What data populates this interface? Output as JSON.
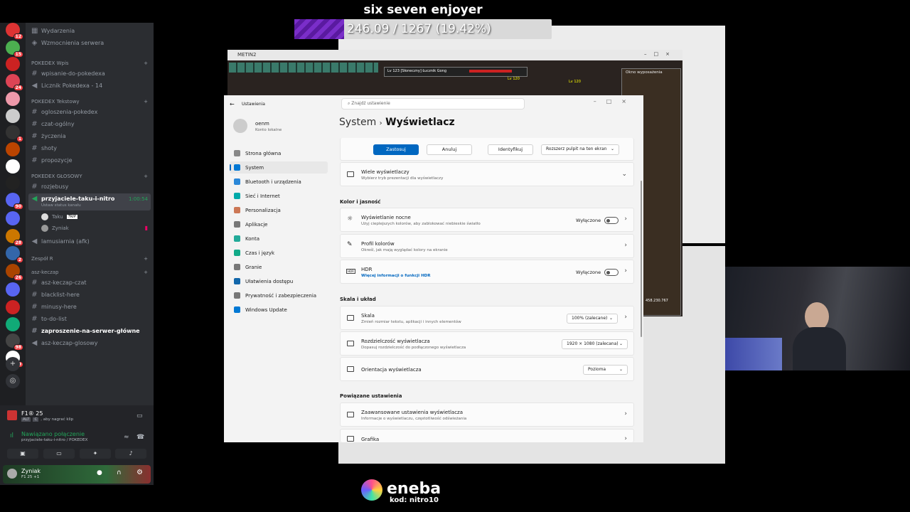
{
  "overlay": {
    "title": "six seven enjoyer",
    "xp_text": "246.09 / 1267 (19.42%)",
    "xp_fraction": 0.1942,
    "sponsor": "eneba",
    "sponsor_code": "kod: nitro10"
  },
  "rail": {
    "badges": [
      "12",
      "15",
      "",
      "24",
      "",
      "",
      "1",
      "",
      "",
      "",
      "90",
      "",
      "28",
      "2",
      "26",
      "",
      "",
      "",
      "98",
      "269"
    ]
  },
  "channels": {
    "top": [
      "Wydarzenia",
      "Wzmocnienia serwera"
    ],
    "cat1": "POKEDEX Wpis",
    "cat1_items": [
      "wpisanie-do-pokedexa",
      "Licznik Pokedexa - 14"
    ],
    "cat2": "POKEDEX Tekstowy",
    "cat2_items": [
      "ogloszenia-pokedex",
      "czat-ogólny",
      "życzenia",
      "shoty",
      "propozycje"
    ],
    "cat3": "POKEDEX GŁOSOWY",
    "cat3_items": [
      "rozjebusy"
    ],
    "voice_active": "przyjaciele-taku-i-nitro",
    "voice_time": "1:00:54",
    "voice_status": "Ustaw status kanału",
    "voice_users": [
      "Taku",
      "Zyniak"
    ],
    "taku_tag": "TRIP",
    "afk": "lamusiarnia (afk)",
    "cat4": "Zespół R",
    "cat5": "asz-keczap",
    "cat5_items": [
      "asz-keczap-czat",
      "blacklist-here",
      "minusy-here",
      "to-do-list",
      "zaproszenie-na-serwer-główne",
      "asz-keczap-glosowy"
    ]
  },
  "panel": {
    "game": "F1® 25",
    "clip_hint": ", aby nagrać klip",
    "key1": "ALT",
    "key2": "C",
    "connected": "Nawiązano połączenie",
    "connected_sub": "przyjaciele-taku-i-nitro / POKEDEX",
    "user": "Zyniak",
    "user_status": "F1 25 +1"
  },
  "game": {
    "title": "METIN2",
    "target": "Lv 123 [Słoneczny] Łucznik Gong",
    "inv_title": "Okno wyposażenia",
    "lv1": "Lv 120",
    "lv2": "Lv 120",
    "gold": "458.230.767"
  },
  "settings": {
    "title": "Ustawienia",
    "search": "Znajdź ustawienie",
    "user_name": "oenm",
    "user_sub": "Konto lokalne",
    "breadcrumb": "System",
    "page": "Wyświetlacz",
    "nav": [
      "Strona główna",
      "System",
      "Bluetooth i urządzenia",
      "Sieć i Internet",
      "Personalizacja",
      "Aplikacje",
      "Konta",
      "Czas i język",
      "Granie",
      "Ułatwienia dostępu",
      "Prywatność i zabezpieczenia",
      "Windows Update"
    ],
    "apply": "Zastosuj",
    "cancel": "Anuluj",
    "identify": "Identyfikuj",
    "extend": "Rozszerz pulpit na ten ekran",
    "multi_title": "Wiele wyświetlaczy",
    "multi_sub": "Wybierz tryb prezentacji dla wyświetlaczy",
    "color_section": "Kolor i jasność",
    "night_title": "Wyświetlanie nocne",
    "night_sub": "Użyj cieplejszych kolorów, aby zablokować niebieskie światło",
    "night_state": "Wyłączone",
    "profile_title": "Profil kolorów",
    "profile_sub": "Określ, jak mają wyglądać kolory na ekranie",
    "hdr_title": "HDR",
    "hdr_sub": "Więcej informacji o funkcji HDR",
    "hdr_state": "Wyłączone",
    "scale_section": "Skala i układ",
    "scale_title": "Skala",
    "scale_sub": "Zmień rozmiar tekstu, aplikacji i innych elementów",
    "scale_value": "100% (zalecane)",
    "res_title": "Rozdzielczość wyświetlacza",
    "res_sub": "Dopasuj rozdzielczość do podłączonego wyświetlacza",
    "res_value": "1920 × 1080 (zalecana)",
    "orient_title": "Orientacja wyświetlacza",
    "orient_value": "Pozioma",
    "related_section": "Powiązane ustawienia",
    "adv_title": "Zaawansowane ustawienia wyświetlacza",
    "adv_sub": "Informacje o wyświetlaczu, częstotliwość odświeżania",
    "gfx_title": "Grafika"
  }
}
